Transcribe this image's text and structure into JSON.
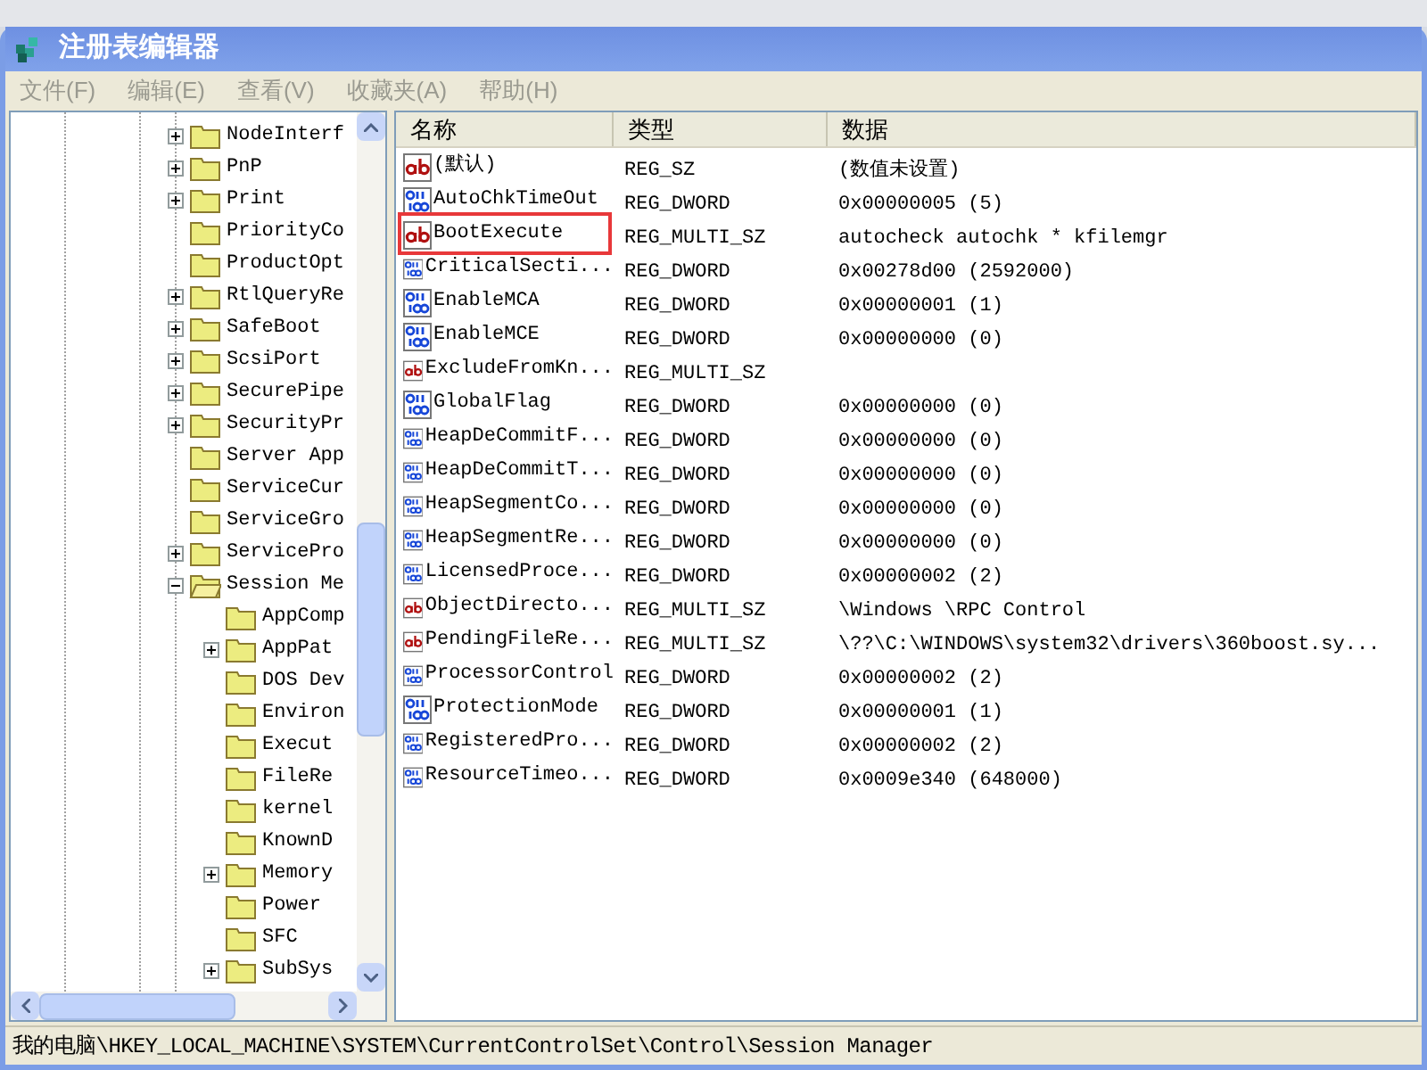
{
  "window": {
    "title": "注册表编辑器"
  },
  "menu": [
    {
      "label": "文件(F)"
    },
    {
      "label": "编辑(E)"
    },
    {
      "label": "查看(V)"
    },
    {
      "label": "收藏夹(A)"
    },
    {
      "label": "帮助(H)"
    }
  ],
  "tree": {
    "items": [
      {
        "label": "NodeInterf",
        "expandable": true,
        "expanded": false
      },
      {
        "label": "PnP",
        "expandable": true,
        "expanded": false
      },
      {
        "label": "Print",
        "expandable": true,
        "expanded": false
      },
      {
        "label": "PriorityCo",
        "expandable": false,
        "expanded": false
      },
      {
        "label": "ProductOpt",
        "expandable": false,
        "expanded": false
      },
      {
        "label": "RtlQueryRe",
        "expandable": true,
        "expanded": false
      },
      {
        "label": "SafeBoot",
        "expandable": true,
        "expanded": false
      },
      {
        "label": "ScsiPort",
        "expandable": true,
        "expanded": false
      },
      {
        "label": "SecurePipe",
        "expandable": true,
        "expanded": false
      },
      {
        "label": "SecurityPr",
        "expandable": true,
        "expanded": false
      },
      {
        "label": "Server App",
        "expandable": false,
        "expanded": false
      },
      {
        "label": "ServiceCur",
        "expandable": false,
        "expanded": false
      },
      {
        "label": "ServiceGro",
        "expandable": false,
        "expanded": false
      },
      {
        "label": "ServicePro",
        "expandable": true,
        "expanded": false
      },
      {
        "label": "Session Me",
        "expandable": true,
        "expanded": true,
        "children": [
          {
            "label": "AppComp",
            "expandable": false,
            "expanded": false
          },
          {
            "label": "AppPat",
            "expandable": true,
            "expanded": false
          },
          {
            "label": "DOS Dev",
            "expandable": false,
            "expanded": false
          },
          {
            "label": "Environ",
            "expandable": false,
            "expanded": false
          },
          {
            "label": "Execut",
            "expandable": false,
            "expanded": false
          },
          {
            "label": "FileRe",
            "expandable": false,
            "expanded": false
          },
          {
            "label": "kernel",
            "expandable": false,
            "expanded": false
          },
          {
            "label": "KnownD",
            "expandable": false,
            "expanded": false
          },
          {
            "label": "Memory",
            "expandable": true,
            "expanded": false
          },
          {
            "label": "Power",
            "expandable": false,
            "expanded": false
          },
          {
            "label": "SFC",
            "expandable": false,
            "expanded": false
          },
          {
            "label": "SubSys",
            "expandable": true,
            "expanded": false
          }
        ]
      }
    ]
  },
  "table": {
    "columns": [
      "名称",
      "类型",
      "数据"
    ],
    "rows": [
      {
        "kind": "string",
        "name": "(默认)",
        "type": "REG_SZ",
        "data": "(数值未设置)",
        "highlighted": false
      },
      {
        "kind": "binary",
        "name": "AutoChkTimeOut",
        "type": "REG_DWORD",
        "data": "0x00000005 (5)",
        "highlighted": false
      },
      {
        "kind": "string",
        "name": "BootExecute",
        "type": "REG_MULTI_SZ",
        "data": "autocheck autochk * kfilemgr",
        "highlighted": true
      },
      {
        "kind": "binary",
        "name": "CriticalSecti...",
        "type": "REG_DWORD",
        "data": "0x00278d00 (2592000)",
        "highlighted": false
      },
      {
        "kind": "binary",
        "name": "EnableMCA",
        "type": "REG_DWORD",
        "data": "0x00000001 (1)",
        "highlighted": false
      },
      {
        "kind": "binary",
        "name": "EnableMCE",
        "type": "REG_DWORD",
        "data": "0x00000000 (0)",
        "highlighted": false
      },
      {
        "kind": "string",
        "name": "ExcludeFromKn...",
        "type": "REG_MULTI_SZ",
        "highlighted": false
      },
      {
        "kind": "binary",
        "name": "GlobalFlag",
        "type": "REG_DWORD",
        "data": "0x00000000 (0)",
        "highlighted": false
      },
      {
        "kind": "binary",
        "name": "HeapDeCommitF...",
        "type": "REG_DWORD",
        "data": "0x00000000 (0)",
        "highlighted": false
      },
      {
        "kind": "binary",
        "name": "HeapDeCommitT...",
        "type": "REG_DWORD",
        "data": "0x00000000 (0)",
        "highlighted": false
      },
      {
        "kind": "binary",
        "name": "HeapSegmentCo...",
        "type": "REG_DWORD",
        "data": "0x00000000 (0)",
        "highlighted": false
      },
      {
        "kind": "binary",
        "name": "HeapSegmentRe...",
        "type": "REG_DWORD",
        "data": "0x00000000 (0)",
        "highlighted": false
      },
      {
        "kind": "binary",
        "name": "LicensedProce...",
        "type": "REG_DWORD",
        "data": "0x00000002 (2)",
        "highlighted": false
      },
      {
        "kind": "string",
        "name": "ObjectDirecto...",
        "type": "REG_MULTI_SZ",
        "data": "\\Windows \\RPC Control",
        "highlighted": false
      },
      {
        "kind": "string",
        "name": "PendingFileRe...",
        "type": "REG_MULTI_SZ",
        "data": "\\??\\C:\\WINDOWS\\system32\\drivers\\360boost.sy...",
        "highlighted": false
      },
      {
        "kind": "binary",
        "name": "ProcessorControl",
        "type": "REG_DWORD",
        "data": "0x00000002 (2)",
        "highlighted": false
      },
      {
        "kind": "binary",
        "name": "ProtectionMode",
        "type": "REG_DWORD",
        "data": "0x00000001 (1)",
        "highlighted": false
      },
      {
        "kind": "binary",
        "name": "RegisteredPro...",
        "type": "REG_DWORD",
        "data": "0x00000002 (2)",
        "highlighted": false
      },
      {
        "kind": "binary",
        "name": "ResourceTimeo...",
        "type": "REG_DWORD",
        "data": "0x0009e340 (648000)",
        "highlighted": false
      }
    ]
  },
  "status_bar": "我的电脑\\HKEY_LOCAL_MACHINE\\SYSTEM\\CurrentControlSet\\Control\\Session Manager"
}
